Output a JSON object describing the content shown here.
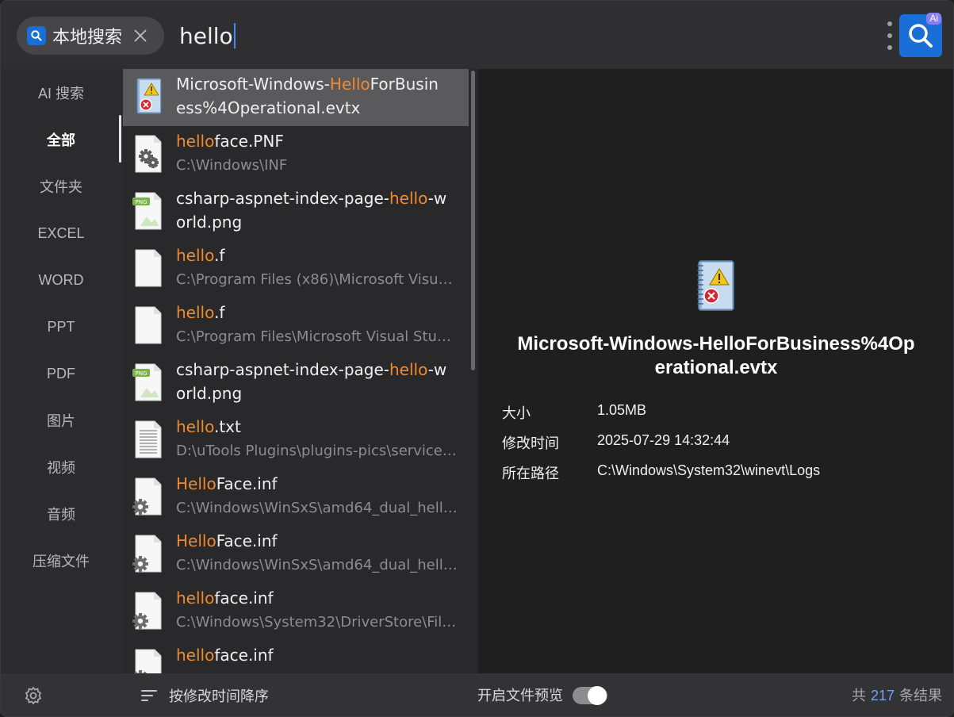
{
  "search": {
    "scope_label": "本地搜索",
    "query": "hello"
  },
  "nav": {
    "items": [
      {
        "label": "AI 搜索"
      },
      {
        "label": "全部"
      },
      {
        "label": "文件夹"
      },
      {
        "label": "EXCEL"
      },
      {
        "label": "WORD"
      },
      {
        "label": "PPT"
      },
      {
        "label": "PDF"
      },
      {
        "label": "图片"
      },
      {
        "label": "视频"
      },
      {
        "label": "音频"
      },
      {
        "label": "压缩文件"
      }
    ],
    "active_index": 1
  },
  "results": [
    {
      "icon": "event-log-icon",
      "pre": "Microsoft-Windows-",
      "hl": "Hello",
      "post": "ForBusin",
      "second": "ess%4Operational.evtx",
      "second_is_title": true
    },
    {
      "icon": "settings-file-icon",
      "pre": "",
      "hl": "hello",
      "post": "face.PNF",
      "second": "C:\\Windows\\INF",
      "second_is_title": false
    },
    {
      "icon": "png-file-icon",
      "pre": "csharp-aspnet-index-page-",
      "hl": "hello",
      "post": "-w",
      "second": "orld.png",
      "second_is_title": true
    },
    {
      "icon": "blank-file-icon",
      "pre": "",
      "hl": "hello",
      "post": ".f",
      "second": "C:\\Program Files (x86)\\Microsoft Visual...",
      "second_is_title": false
    },
    {
      "icon": "blank-file-icon",
      "pre": "",
      "hl": "hello",
      "post": ".f",
      "second": "C:\\Program Files\\Microsoft Visual Studi...",
      "second_is_title": false
    },
    {
      "icon": "png-file-icon",
      "pre": "csharp-aspnet-index-page-",
      "hl": "hello",
      "post": "-w",
      "second": "orld.png",
      "second_is_title": true
    },
    {
      "icon": "text-file-icon",
      "pre": "",
      "hl": "hello",
      "post": ".txt",
      "second": "D:\\uTools Plugins\\plugins-pics\\services...",
      "second_is_title": false
    },
    {
      "icon": "inf-file-icon",
      "pre": "",
      "hl": "Hello",
      "post": "Face.inf",
      "second": "C:\\Windows\\WinSxS\\amd64_dual_hello...",
      "second_is_title": false
    },
    {
      "icon": "inf-file-icon",
      "pre": "",
      "hl": "Hello",
      "post": "Face.inf",
      "second": "C:\\Windows\\WinSxS\\amd64_dual_hello...",
      "second_is_title": false
    },
    {
      "icon": "inf-file-icon",
      "pre": "",
      "hl": "hello",
      "post": "face.inf",
      "second": "C:\\Windows\\System32\\DriverStore\\File...",
      "second_is_title": false
    },
    {
      "icon": "inf-file-icon",
      "pre": "",
      "hl": "hello",
      "post": "face.inf",
      "second": "",
      "second_is_title": false
    }
  ],
  "preview": {
    "title_line1": "Microsoft-Windows-HelloForBusiness%4Op",
    "title_line2": "erational.evtx",
    "meta": [
      {
        "key": "大小",
        "value": "1.05MB"
      },
      {
        "key": "修改时间",
        "value": "2025-07-29 14:32:44"
      },
      {
        "key": "所在路径",
        "value": "C:\\Windows\\System32\\winevt\\Logs"
      }
    ]
  },
  "footer": {
    "sort_label": "按修改时间降序",
    "preview_toggle_label": "开启文件预览",
    "preview_enabled": true,
    "count_prefix": "共",
    "count": "217",
    "count_suffix": "条结果"
  },
  "ai_badge": "Ai",
  "colors": {
    "accent": "#1a6fd6",
    "highlight": "#f08a2e",
    "count_number": "#6aa4f2"
  }
}
